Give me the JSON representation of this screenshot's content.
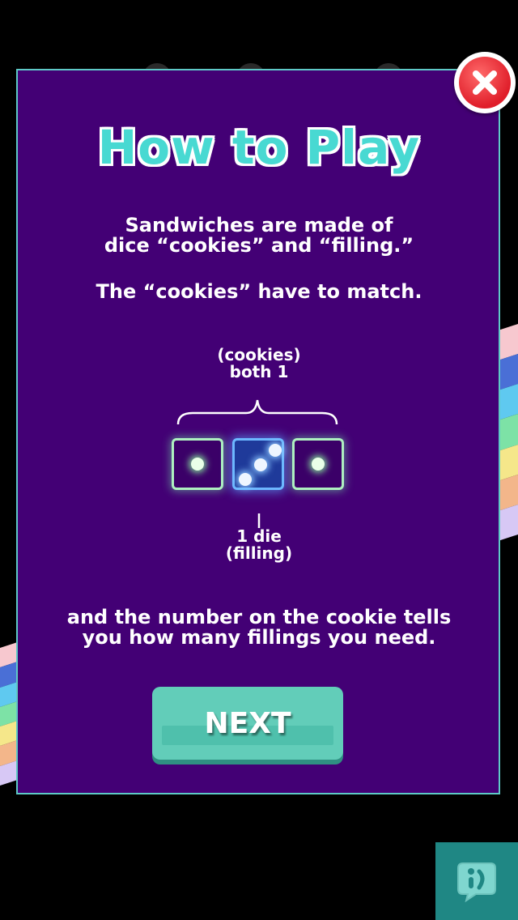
{
  "modal": {
    "title": "How to Play",
    "intro": "Sandwiches are made of\ndice “cookies” and “filling.”",
    "rule": "The “cookies” have to match.",
    "cookies_label": "(cookies)\nboth 1",
    "filling_label": "1 die\n(filling)",
    "explanation": "and the number on the cookie tells\nyou how many fillings you need.",
    "next_label": "NEXT"
  },
  "dice": [
    {
      "role": "cookie",
      "value": 1
    },
    {
      "role": "filling",
      "value": 3
    },
    {
      "role": "cookie",
      "value": 1
    }
  ],
  "icons": {
    "close": "close-icon",
    "corner_app": "chat-bubble-icon"
  },
  "colors": {
    "modal_bg": "#430075",
    "title": "#48d9d2",
    "next_button": "#62cdb9",
    "close_button": "#e01e2a",
    "corner_button": "#1f8784"
  },
  "ribbon_colors": [
    "#f7c8cf",
    "#4a6fd6",
    "#5fc9f0",
    "#7de2a6",
    "#f5e78a",
    "#f3b68a",
    "#d7c8f5"
  ]
}
